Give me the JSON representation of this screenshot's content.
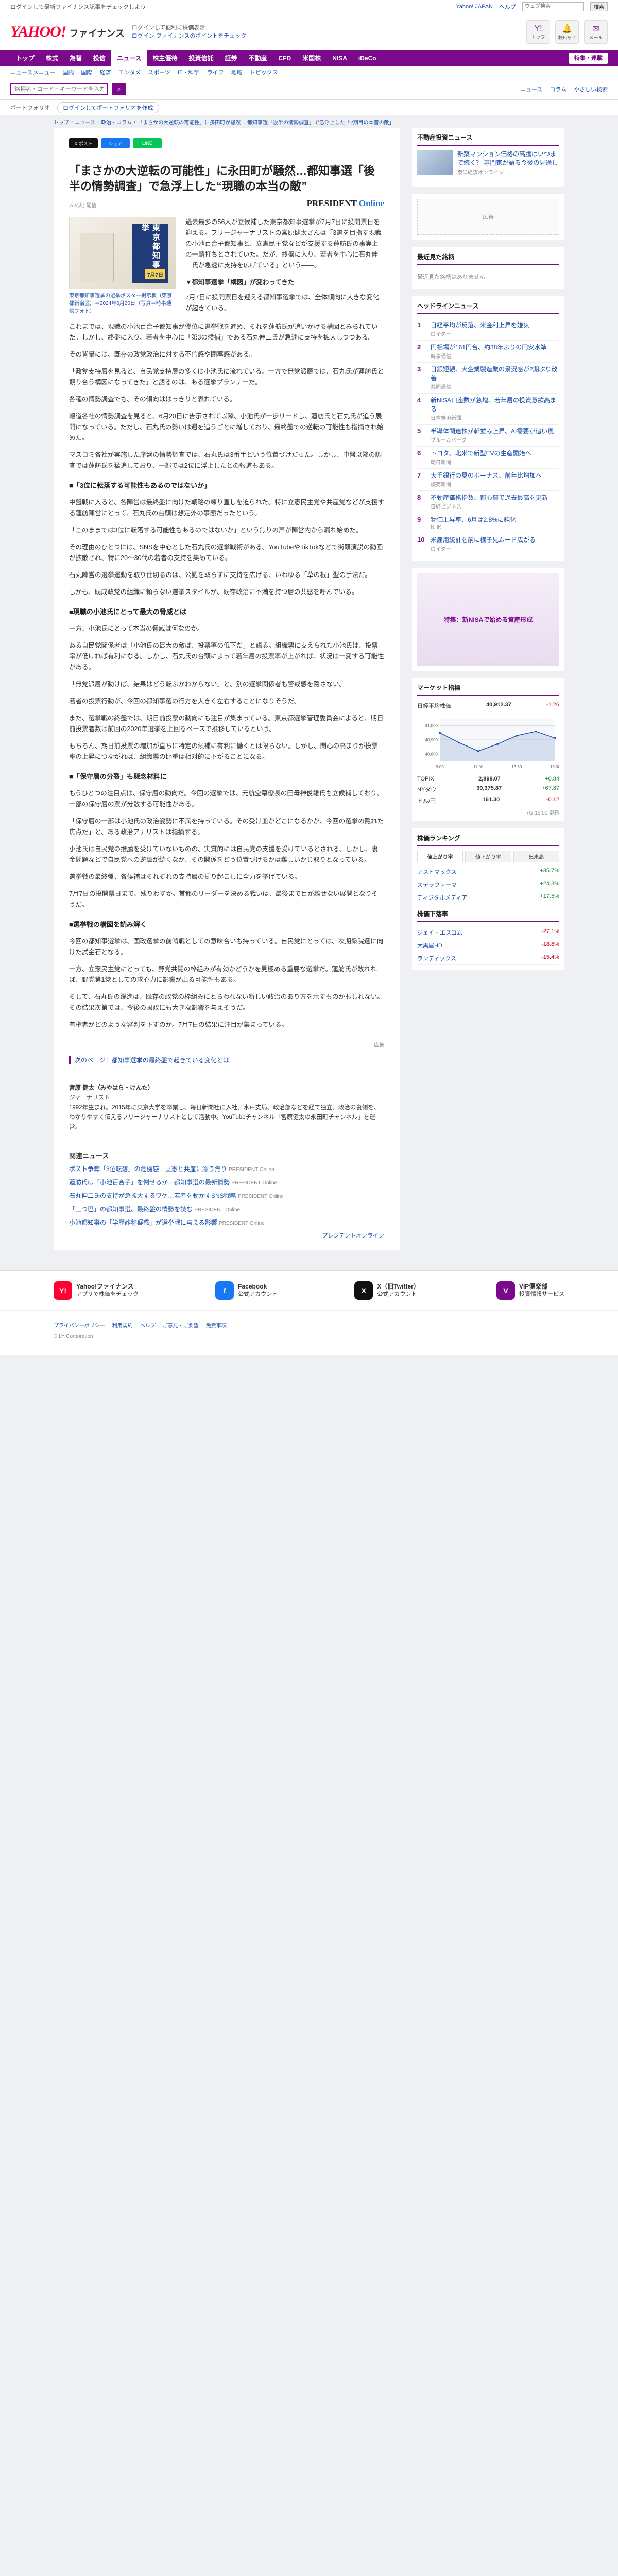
{
  "topbar": {
    "notice": "ログインして最新ファイナンス記事をチェックしよう",
    "right_links": [
      "Yahoo! JAPAN",
      "ヘルプ"
    ],
    "search_placeholder": "ウェブ検索",
    "search_button": "検索"
  },
  "header": {
    "logo": "YAHOO!",
    "logo_sub": "ファイナンス",
    "info_line1": "ログインして便利に株価表示",
    "info_line2_prefix": "ログイン",
    "info_line2_link": "ファイナンスのポイントをチェック",
    "icons": [
      {
        "icon": "yahoo-icon",
        "glyph": "Y!",
        "label": "トップ"
      },
      {
        "icon": "bell-icon",
        "glyph": "🔔",
        "label": "お知らせ"
      },
      {
        "icon": "mail-icon",
        "glyph": "✉",
        "label": "メール"
      }
    ]
  },
  "nav": {
    "items": [
      "トップ",
      "株式",
      "為替",
      "投信",
      "ニュース",
      "株主優待",
      "投資信託",
      "証券",
      "不動産",
      "CFD",
      "米国株",
      "NISA",
      "iDeCo"
    ],
    "active_index": 4,
    "right_button": "特集・連載"
  },
  "subnav": {
    "items": [
      "ニュースメニュー",
      "国内",
      "国際",
      "経済",
      "エンタメ",
      "スポーツ",
      "IT・科学",
      "ライフ",
      "地域",
      "トピックス"
    ]
  },
  "search": {
    "placeholder": "銘柄名・コード・キーワードを入力",
    "right_links": [
      "ニュース",
      "コラム"
    ],
    "settings": "やさしい検索"
  },
  "promo": {
    "tag": "ポートフォリオ",
    "pill": "ログインしてポートフォリオを作成"
  },
  "breadcrumb": [
    "トップ",
    "ニュース",
    "政治・コラム",
    "「まさかの大逆転の可能性」に多田町が騒然 …都知事選「後半の情勢調査」で急浮上した「2期目の本音の敵」"
  ],
  "article": {
    "share": [
      {
        "label": "X ポスト",
        "color": "#111111"
      },
      {
        "label": "シェア",
        "color": "#1877f2"
      },
      {
        "label": "LINE",
        "color": "#06c755"
      }
    ],
    "title": "「まさかの大逆転の可能性」に永田町が騒然…都知事選「後半の情勢調査」で急浮上した“現職の本当の敵”",
    "date": "7/2(火) 配信",
    "publisher_main": "PRESIDENT",
    "publisher_sub": "Online",
    "photo_sign": "東京都知事選挙",
    "photo_badge": "7月7日",
    "photo_caption": "東京都知事選挙の選挙ポスター掲示板（東京都新宿区）＝2024年6月20日（写真＝時事通信フォト）",
    "lead": "過去最多の56人が立候補した東京都知事選挙が7月7日に投開票日を迎える。フリージャーナリストの宮原健太さんは「3選を目指す現職の小池百合子都知事と、立憲民主党などが支援する蓮舫氏の事実上の一騎打ちとされていた。だが、終盤に入り、若者を中心に石丸伸二氏が急速に支持を広げている」という――。",
    "lead2": "▼都知事選挙「構図」が変わってきた",
    "lead3": "7月7日に投開票日を迎える都知事選挙では、全体傾向に大きな変化が起きている。",
    "paragraphs": [
      "これまでは、現職の小池百合子都知事が優位に選挙戦を進め、それを蓮舫氏が追いかける構図とみられていた。しかし、終盤に入り、若者を中心に「第3の候補」である石丸伸二氏が急速に支持を拡大しつつある。",
      "その背景には、既存の政党政治に対する不信感や閉塞感がある。",
      "「政党支持層を見ると、自民党支持層の多くは小池氏に流れている。一方で無党派層では、石丸氏が蓮舫氏と競り合う構図になってきた」と語るのは、ある選挙プランナーだ。",
      "各種の情勢調査でも、その傾向ははっきりと表れている。",
      "報道各社の情勢調査を見ると、6月20日に告示されて以降、小池氏が一歩リードし、蓮舫氏と石丸氏が追う展開になっている。ただし、石丸氏の勢いは週を追うごとに増しており、最終盤での逆転の可能性も指摘され始めた。",
      "マスコミ各社が実施した序盤の情勢調査では、石丸氏は3番手という位置づけだった。しかし、中盤以降の調査では蓮舫氏を猛追しており、一部では2位に浮上したとの報道もある。"
    ],
    "heading1": "■「3位に転落する可能性もあるのではないか」",
    "paragraphs2": [
      "中盤戦に入ると、各陣営は最終盤に向けた戦略の練り直しを迫られた。特に立憲民主党や共産党などが支援する蓮舫陣営にとって、石丸氏の台頭は想定外の事態だったという。",
      "「このままでは3位に転落する可能性もあるのではないか」という焦りの声が陣営内から漏れ始めた。",
      "その理由のひとつには、SNSを中心とした石丸氏の選挙戦術がある。YouTubeやTikTokなどで街頭演説の動画が拡散され、特に20〜30代の若者の支持を集めている。",
      "石丸陣営の選挙運動を取り仕切るのは、公認を取らずに支持を広げる、いわゆる「草の根」型の手法だ。",
      "しかも、既成政党の組織に頼らない選挙スタイルが、既存政治に不満を持つ層の共感を呼んでいる。"
    ],
    "heading2": "■現職の小池氏にとって最大の脅威とは",
    "paragraphs3": [
      "一方、小池氏にとって本当の脅威は何なのか。",
      "ある自民党関係者は「小池氏の最大の敵は、投票率の低下だ」と語る。組織票に支えられた小池氏は、投票率が低ければ有利になる。しかし、石丸氏の台頭によって若年層の投票率が上がれば、状況は一変する可能性がある。",
      "「無党派層が動けば、結果はどう転ぶかわからない」と、別の選挙関係者も警戒感を隠さない。",
      "若者の投票行動が、今回の都知事選の行方を大きく左右することになりそうだ。",
      "また、選挙戦の終盤では、期日前投票の動向にも注目が集まっている。東京都選挙管理委員会によると、期日前投票者数は前回の2020年選挙を上回るペースで推移しているという。",
      "もちろん、期日前投票の増加が直ちに特定の候補に有利に働くとは限らない。しかし、関心の高まりが投票率の上昇につながれば、組織票の比重は相対的に下がることになる。"
    ],
    "heading3": "■「保守層の分裂」も懸念材料に",
    "paragraphs4": [
      "もうひとつの注目点は、保守層の動向だ。今回の選挙では、元航空幕僚長の田母神俊雄氏も立候補しており、一部の保守層の票が分散する可能性がある。",
      "「保守層の一部は小池氏の政治姿勢に不満を持っている。その受け皿がどこになるかが、今回の選挙の隠れた焦点だ」と、ある政治アナリストは指摘する。",
      "小池氏は自民党の推薦を受けていないものの、実質的には自民党の支援を受けているとされる。しかし、裏金問題などで自民党への逆風が続くなか、その関係をどう位置づけるかは難しいかじ取りとなっている。",
      "選挙戦の最終盤、各候補はそれぞれの支持層の掘り起こしに全力を挙げている。",
      "7月7日の投開票日まで、残りわずか。首都のリーダーを決める戦いは、最後まで目が離せない展開となりそうだ。"
    ],
    "heading4": "■選挙戦の構図を読み解く",
    "paragraphs5": [
      "今回の都知事選挙は、国政選挙の前哨戦としての意味合いも持っている。自民党にとっては、次期衆院選に向けた試金石となる。",
      "一方、立憲民主党にとっても、野党共闘の枠組みが有効かどうかを見極める重要な選挙だ。蓮舫氏が敗れれば、野党第1党としての求心力に影響が出る可能性もある。",
      "そして、石丸氏の躍進は、既存の政党の枠組みにとらわれない新しい政治のあり方を示すものかもしれない。その結果次第では、今後の国政にも大きな影響を与えそうだ。",
      "有権者がどのような審判を下すのか。7月7日の結果に注目が集まっている。"
    ],
    "ad_label": "広告",
    "more_link": "次のページ：都知事選挙の最終盤で起きている変化とは",
    "author": {
      "name": "宮原 健太（みやはら・けんた）",
      "role": "ジャーナリスト",
      "bio": "1992年生まれ。2015年に東京大学を卒業し、毎日新聞社に入社。水戸支局、政治部などを経て独立。政治の裏側を、わかりやすく伝えるフリージャーナリストとして活動中。YouTubeチャンネル「宮原健太の永田町チャンネル」を運営。"
    },
    "related_title": "関連ニュース",
    "related": [
      {
        "title": "ポスト争奪「3位転落」の危機感…立憲と共産に漂う焦り",
        "pub": "PRESIDENT Online"
      },
      {
        "title": "蓮舫氏は「小池百合子」を倒せるか…都知事選の最新情勢",
        "pub": "PRESIDENT Online"
      },
      {
        "title": "石丸伸二氏の支持が急拡大するワケ…若者を動かすSNS戦略",
        "pub": "PRESIDENT Online"
      },
      {
        "title": "「三つ巴」の都知事選、最終盤の情勢を読む",
        "pub": "PRESIDENT Online"
      },
      {
        "title": "小池都知事の「学歴詐称疑惑」が選挙戦に与える影響",
        "pub": "PRESIDENT Online"
      }
    ],
    "related_footer": "プレジデントオンライン"
  },
  "sidebar": {
    "feature_title": "不動産投資ニュース",
    "feature_news": [
      {
        "title": "新築マンション価格の高騰はいつまで続く？ 専門家が語る今後の見通し",
        "pub": "東洋経済オンライン"
      }
    ],
    "ad_text": "広告",
    "latest_title": "最近見た銘柄",
    "latest_note": "最近見た銘柄はありません",
    "headline_title": "ヘッドラインニュース",
    "headlines": [
      {
        "title": "日経平均が反落、米金利上昇を嫌気",
        "pub": "ロイター"
      },
      {
        "title": "円相場が161円台、約38年ぶりの円安水準",
        "pub": "時事通信"
      },
      {
        "title": "日銀短観、大企業製造業の景況感が2期ぶり改善",
        "pub": "共同通信"
      },
      {
        "title": "新NISA口座数が急増、若年層の投資意欲高まる",
        "pub": "日本経済新聞"
      },
      {
        "title": "半導体関連株が軒並み上昇、AI需要が追い風",
        "pub": "ブルームバーグ"
      },
      {
        "title": "トヨタ、北米で新型EVの生産開始へ",
        "pub": "朝日新聞"
      },
      {
        "title": "大手銀行の夏のボーナス、前年比増加へ",
        "pub": "読売新聞"
      },
      {
        "title": "不動産価格指数、都心部で過去最高を更新",
        "pub": "日経ビジネス"
      },
      {
        "title": "物価上昇率、6月は2.8%に鈍化",
        "pub": "NHK"
      },
      {
        "title": "米雇用統計を前に様子見ムード広がる",
        "pub": "ロイター"
      }
    ],
    "topics_ad": "特集：新NISAで始める資産形成",
    "market_title": "マーケット指標",
    "market": [
      {
        "name": "日経平均株価",
        "value": "40,912.37",
        "change": "-1.26",
        "dir": "neg"
      },
      {
        "name": "TOPIX",
        "value": "2,898.07",
        "change": "+0.84",
        "dir": "pos"
      },
      {
        "name": "NYダウ",
        "value": "39,375.87",
        "change": "+67.87",
        "dir": "pos"
      },
      {
        "name": "ドル/円",
        "value": "161.30",
        "change": "-0.12",
        "dir": "neg"
      }
    ],
    "market_update": "7/2 15:00 更新",
    "chart_data": {
      "type": "line",
      "title": "日経平均株価",
      "x": [
        "9:00",
        "10:00",
        "11:00",
        "12:30",
        "13:30",
        "14:30",
        "15:00"
      ],
      "values": [
        40950,
        40880,
        40820,
        40870,
        40930,
        40960,
        40912
      ],
      "ylim": [
        40750,
        41050
      ],
      "yticks": [
        "41,000",
        "40,900",
        "40,800"
      ]
    },
    "stock_title": "株価ランキング",
    "stock_tabs": [
      "値上がり率",
      "値下がり率",
      "出来高"
    ],
    "stocks_up": [
      {
        "name": "アストマックス",
        "change": "+35.7%"
      },
      {
        "name": "ステラファーマ",
        "change": "+24.3%"
      },
      {
        "name": "ディジタルメディア",
        "change": "+17.5%"
      }
    ],
    "stock_title2": "株価下落率",
    "stocks_down": [
      {
        "name": "ジェイ・エスコム",
        "change": "-27.1%"
      },
      {
        "name": "大黒屋HD",
        "change": "-18.8%"
      },
      {
        "name": "ランディックス",
        "change": "-15.4%"
      }
    ]
  },
  "footer": {
    "apps": [
      {
        "glyph": "Y!",
        "color": "#ff0033",
        "name": "Yahoo!ファイナンス",
        "desc": "アプリで株価をチェック"
      },
      {
        "glyph": "f",
        "color": "#1877f2",
        "name": "Facebook",
        "desc": "公式アカウント"
      },
      {
        "glyph": "X",
        "color": "#111111",
        "name": "X（旧Twitter）",
        "desc": "公式アカウント"
      },
      {
        "glyph": "V",
        "color": "#7a0a8a",
        "name": "VIP倶楽部",
        "desc": "投資情報サービス"
      }
    ],
    "links": [
      "プライバシーポリシー",
      "利用規約",
      "ヘルプ",
      "ご意見・ご要望",
      "免責事項"
    ],
    "copyright": "© LY Corporation"
  }
}
